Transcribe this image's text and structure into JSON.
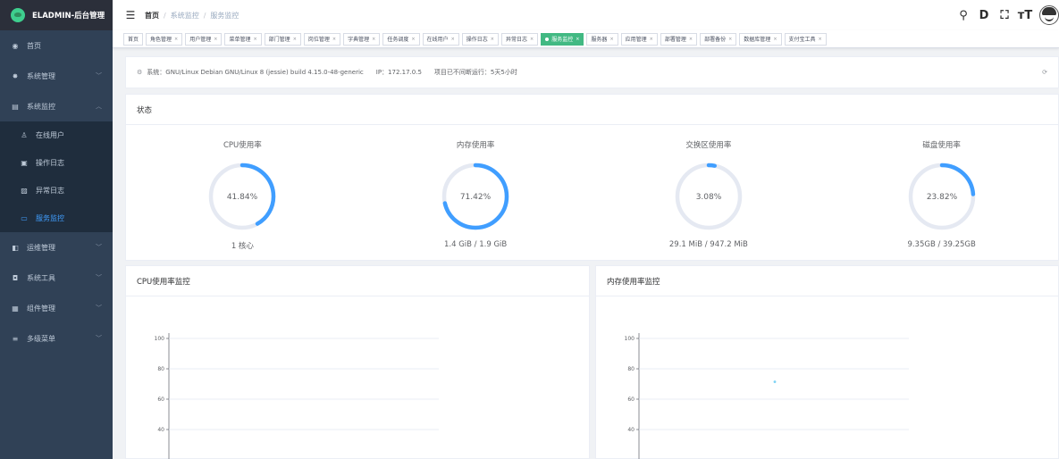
{
  "app": {
    "title": "ELADMIN-后台管理"
  },
  "sidebar": {
    "items": [
      {
        "label": "首页",
        "icon": "dashboard-icon",
        "glyph": "◉"
      },
      {
        "label": "系统管理",
        "icon": "gear-icon",
        "glyph": "✸"
      },
      {
        "label": "系统监控",
        "icon": "monitor-icon",
        "glyph": "▤"
      },
      {
        "label": "运维管理",
        "icon": "server-icon",
        "glyph": "◧"
      },
      {
        "label": "系统工具",
        "icon": "toolbox-icon",
        "glyph": "◘"
      },
      {
        "label": "组件管理",
        "icon": "grid-icon",
        "glyph": "▦"
      },
      {
        "label": "多级菜单",
        "icon": "list-icon",
        "glyph": "≡"
      }
    ],
    "monitor_sub": [
      {
        "label": "在线用户",
        "icon": "online-user-icon",
        "glyph": "♙"
      },
      {
        "label": "操作日志",
        "icon": "log-icon",
        "glyph": "▣"
      },
      {
        "label": "异常日志",
        "icon": "error-log-icon",
        "glyph": "▨"
      },
      {
        "label": "服务监控",
        "icon": "service-monitor-icon",
        "glyph": "▭"
      }
    ]
  },
  "breadcrumb": [
    "首页",
    "系统监控",
    "服务监控"
  ],
  "header_icons": {
    "search": {
      "name": "search-icon",
      "glyph": "⚲"
    },
    "docs": {
      "name": "docs-icon",
      "glyph": "D"
    },
    "fullscreen": {
      "name": "fullscreen-icon",
      "glyph": "⛶"
    },
    "size": {
      "name": "size-icon",
      "glyph": "тT"
    }
  },
  "tags": [
    {
      "label": "首页",
      "closable": false,
      "active": false
    },
    {
      "label": "角色管理",
      "closable": true,
      "active": false
    },
    {
      "label": "用户管理",
      "closable": true,
      "active": false
    },
    {
      "label": "菜单管理",
      "closable": true,
      "active": false
    },
    {
      "label": "部门管理",
      "closable": true,
      "active": false
    },
    {
      "label": "岗位管理",
      "closable": true,
      "active": false
    },
    {
      "label": "字典管理",
      "closable": true,
      "active": false
    },
    {
      "label": "任务调度",
      "closable": true,
      "active": false
    },
    {
      "label": "在线用户",
      "closable": true,
      "active": false
    },
    {
      "label": "操作日志",
      "closable": true,
      "active": false
    },
    {
      "label": "异常日志",
      "closable": true,
      "active": false
    },
    {
      "label": "服务监控",
      "closable": true,
      "active": true
    },
    {
      "label": "服务器",
      "closable": true,
      "active": false
    },
    {
      "label": "应用管理",
      "closable": true,
      "active": false
    },
    {
      "label": "部署管理",
      "closable": true,
      "active": false
    },
    {
      "label": "部署备份",
      "closable": true,
      "active": false
    },
    {
      "label": "数据库管理",
      "closable": true,
      "active": false
    },
    {
      "label": "支付宝工具",
      "closable": true,
      "active": false
    }
  ],
  "sysinfo": {
    "system": "系统：GNU/Linux Debian GNU/Linux 8 (jessie) build 4.15.0-48-generic",
    "ip": "IP：172.17.0.5",
    "uptime": "项目已不间断运行：5天5小时"
  },
  "status": {
    "title": "状态",
    "gauges": [
      {
        "title": "CPU使用率",
        "percent": 41.84,
        "label": "41.84%",
        "sub": "1 核心"
      },
      {
        "title": "内存使用率",
        "percent": 71.42,
        "label": "71.42%",
        "sub": "1.4 GiB / 1.9 GiB"
      },
      {
        "title": "交换区使用率",
        "percent": 3.08,
        "label": "3.08%",
        "sub": "29.1 MiB / 947.2 MiB"
      },
      {
        "title": "磁盘使用率",
        "percent": 23.82,
        "label": "23.82%",
        "sub": "9.35GB / 39.25GB"
      }
    ]
  },
  "monitors": {
    "cpu_title": "CPU使用率监控",
    "mem_title": "内存使用率监控"
  },
  "chart_data": [
    {
      "type": "line",
      "title": "CPU使用率监控",
      "yticks": [
        100,
        80,
        60,
        40
      ],
      "series": [
        {
          "values": []
        }
      ]
    },
    {
      "type": "line",
      "title": "内存使用率监控",
      "yticks": [
        100,
        80,
        60,
        40
      ],
      "series": [
        {
          "values": [
            71.42
          ]
        }
      ]
    }
  ],
  "colors": {
    "accent": "#409eff",
    "gauge_track": "#e5e9f2",
    "active_tag": "#42b983",
    "sidebar_bg": "#304156",
    "point": "#7ed3f4"
  }
}
